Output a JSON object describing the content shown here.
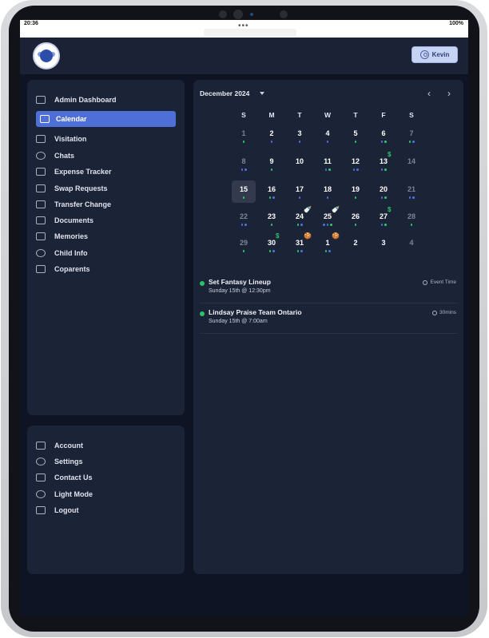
{
  "status": {
    "time": "20:36",
    "dots": "•••",
    "battery": "100%"
  },
  "header": {
    "user_label": "Kevin"
  },
  "sidebar": {
    "items": [
      {
        "label": "Admin Dashboard",
        "icon": "dashboard-icon"
      },
      {
        "label": "Calendar",
        "icon": "calendar-icon",
        "active": true
      },
      {
        "label": "Visitation",
        "icon": "home-icon"
      },
      {
        "label": "Chats",
        "icon": "chat-icon"
      },
      {
        "label": "Expense Tracker",
        "icon": "wallet-icon"
      },
      {
        "label": "Swap Requests",
        "icon": "swap-icon"
      },
      {
        "label": "Transfer Change",
        "icon": "transfer-icon"
      },
      {
        "label": "Documents",
        "icon": "document-icon"
      },
      {
        "label": "Memories",
        "icon": "memories-icon"
      },
      {
        "label": "Child Info",
        "icon": "child-icon"
      },
      {
        "label": "Coparents",
        "icon": "people-icon"
      }
    ],
    "bottom_items": [
      {
        "label": "Account",
        "icon": "account-icon"
      },
      {
        "label": "Settings",
        "icon": "gear-icon"
      },
      {
        "label": "Contact Us",
        "icon": "mail-icon"
      },
      {
        "label": "Light Mode",
        "icon": "sun-icon"
      },
      {
        "label": "Logout",
        "icon": "logout-icon"
      }
    ]
  },
  "calendar": {
    "month_label": "December 2024",
    "weekdays": [
      "S",
      "M",
      "T",
      "W",
      "T",
      "F",
      "S"
    ],
    "weeks": [
      [
        {
          "d": "1",
          "m": true,
          "dots": [
            "#2cc36b"
          ]
        },
        {
          "d": "2",
          "dots": [
            "#4f6fd8"
          ]
        },
        {
          "d": "3",
          "dots": [
            "#4f6fd8"
          ]
        },
        {
          "d": "4",
          "dots": [
            "#4f6fd8"
          ]
        },
        {
          "d": "5",
          "dots": [
            "#2cc36b"
          ]
        },
        {
          "d": "6",
          "dots": [
            "#4f6fd8",
            "#2cc36b"
          ]
        },
        {
          "d": "7",
          "m": true,
          "dots": [
            "#2cc36b",
            "#4f6fd8"
          ]
        }
      ],
      [
        {
          "d": "8",
          "m": true,
          "dots": [
            "#4f6fd8",
            "#4f6fd8"
          ]
        },
        {
          "d": "9",
          "dots": [
            "#2cc36b"
          ]
        },
        {
          "d": "10",
          "dots": []
        },
        {
          "d": "11",
          "dots": [
            "#4f6fd8",
            "#2cc36b"
          ]
        },
        {
          "d": "12",
          "dots": [
            "#4f6fd8",
            "#4f6fd8"
          ]
        },
        {
          "d": "13",
          "dots": [
            "#4f6fd8",
            "#2cc36b"
          ],
          "badge": "$"
        },
        {
          "d": "14",
          "m": true,
          "dots": []
        }
      ],
      [
        {
          "d": "15",
          "today": true,
          "dots": [
            "#2cc36b"
          ]
        },
        {
          "d": "16",
          "dots": [
            "#2cc36b",
            "#4f6fd8"
          ]
        },
        {
          "d": "17",
          "dots": [
            "#4f6fd8"
          ]
        },
        {
          "d": "18",
          "dots": [
            "#4f6fd8"
          ]
        },
        {
          "d": "19",
          "dots": [
            "#2cc36b"
          ]
        },
        {
          "d": "20",
          "dots": [
            "#4f6fd8",
            "#2cc36b"
          ]
        },
        {
          "d": "21",
          "m": true,
          "dots": [
            "#4f6fd8",
            "#4f6fd8"
          ]
        }
      ],
      [
        {
          "d": "22",
          "m": true,
          "dots": [
            "#4f6fd8",
            "#4f6fd8"
          ]
        },
        {
          "d": "23",
          "dots": [
            "#2cc36b"
          ]
        },
        {
          "d": "24",
          "dots": [
            "#2cc36b",
            "#4f6fd8"
          ],
          "badge": "🍼"
        },
        {
          "d": "25",
          "dots": [
            "#4f6fd8",
            "#4f6fd8",
            "#2cc36b"
          ],
          "badge": "🍼"
        },
        {
          "d": "26",
          "dots": [
            "#2cc36b"
          ]
        },
        {
          "d": "27",
          "dots": [
            "#4f6fd8",
            "#2cc36b"
          ],
          "badge": "$"
        },
        {
          "d": "28",
          "m": true,
          "dots": [
            "#2cc36b"
          ]
        }
      ],
      [
        {
          "d": "29",
          "m": true,
          "dots": [
            "#2cc36b"
          ]
        },
        {
          "d": "30",
          "dots": [
            "#2cc36b",
            "#4f6fd8"
          ],
          "badge": "$"
        },
        {
          "d": "31",
          "dots": [
            "#2cc36b",
            "#4f6fd8"
          ],
          "badge": "🍪"
        },
        {
          "d": "1",
          "dots": [
            "#2cc36b",
            "#4f6fd8"
          ],
          "badge": "🍪"
        },
        {
          "d": "2",
          "dots": []
        },
        {
          "d": "3",
          "dots": []
        },
        {
          "d": "4",
          "m": true,
          "dots": []
        }
      ]
    ]
  },
  "events": [
    {
      "title": "Set Fantasy Lineup",
      "subtitle": "Sunday 15th @ 12:30pm",
      "right": "Event Time"
    },
    {
      "title": "Lindsay Praise Team Ontario",
      "subtitle": "Sunday 15th @ 7:00am",
      "right": "30mins"
    }
  ],
  "colors": {
    "accent": "#4f6fd8",
    "green": "#2cc36b",
    "blue_dot": "#4f6fd8"
  }
}
